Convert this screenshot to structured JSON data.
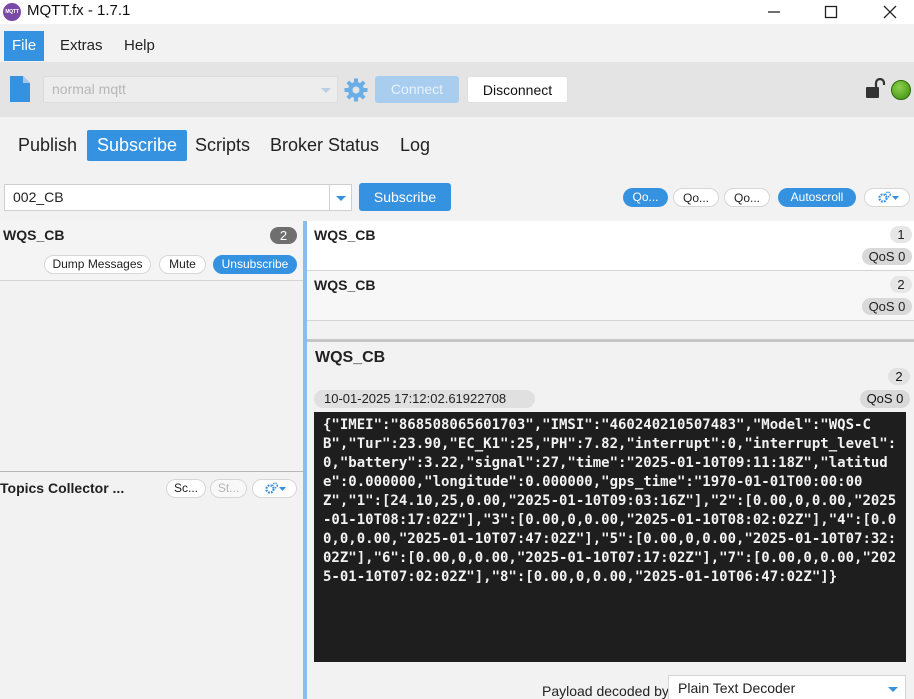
{
  "window": {
    "title": "MQTT.fx - 1.7.1",
    "icon_text": "MQTT"
  },
  "menu": {
    "items": [
      "File",
      "Extras",
      "Help"
    ]
  },
  "toolbar": {
    "profile": "normal mqtt",
    "connect": "Connect",
    "disconnect": "Disconnect"
  },
  "tabs": [
    "Publish",
    "Subscribe",
    "Scripts",
    "Broker Status",
    "Log"
  ],
  "subscribe_bar": {
    "topic": "002_CB",
    "subscribe": "Subscribe",
    "qos_buttons": [
      "Qo...",
      "Qo...",
      "Qo..."
    ],
    "autoscroll": "Autoscroll"
  },
  "subscriptions": [
    {
      "topic": "WQS_CB",
      "count": "2",
      "dump": "Dump Messages",
      "mute": "Mute",
      "unsubscribe": "Unsubscribe"
    }
  ],
  "topics_collector": {
    "title": "Topics Collector ...",
    "scan": "Sc...",
    "stop": "St..."
  },
  "messages": [
    {
      "topic": "WQS_CB",
      "number": "1",
      "qos": "QoS 0"
    },
    {
      "topic": "WQS_CB",
      "number": "2",
      "qos": "QoS 0"
    }
  ],
  "detail": {
    "topic": "WQS_CB",
    "number": "2",
    "timestamp": "10-01-2025  17:12:02.61922708",
    "qos": "QoS 0",
    "payload": "{\"IMEI\":\"868508065601703\",\"IMSI\":\"460240210507483\",\"Model\":\"WQS-CB\",\"Tur\":23.90,\"EC_K1\":25,\"PH\":7.82,\"interrupt\":0,\"interrupt_level\":0,\"battery\":3.22,\"signal\":27,\"time\":\"2025-01-10T09:11:18Z\",\"latitude\":0.000000,\"longitude\":0.000000,\"gps_time\":\"1970-01-01T00:00:00Z\",\"1\":[24.10,25,0.00,\"2025-01-10T09:03:16Z\"],\"2\":[0.00,0,0.00,\"2025-01-10T08:17:02Z\"],\"3\":[0.00,0,0.00,\"2025-01-10T08:02:02Z\"],\"4\":[0.00,0,0.00,\"2025-01-10T07:47:02Z\"],\"5\":[0.00,0,0.00,\"2025-01-10T07:32:02Z\"],\"6\":[0.00,0,0.00,\"2025-01-10T07:17:02Z\"],\"7\":[0.00,0,0.00,\"2025-01-10T07:02:02Z\"],\"8\":[0.00,0,0.00,\"2025-01-10T06:47:02Z\"]}",
    "decoder_label": "Payload decoded by",
    "decoder": "Plain Text Decoder"
  },
  "colors": {
    "accent": "#3592e0",
    "status_connected": "#5aab1e",
    "payload_bg": "#1e1e1e"
  }
}
